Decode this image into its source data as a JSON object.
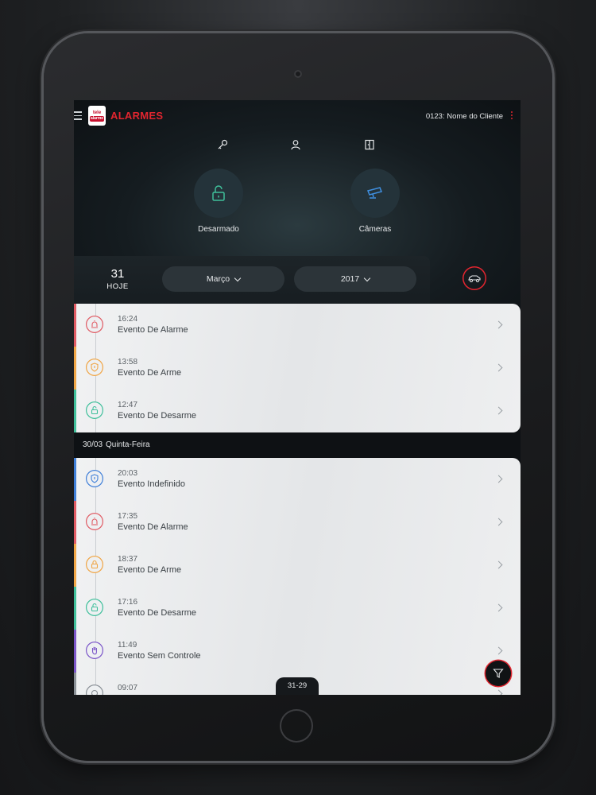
{
  "header": {
    "brand": "ALARMES",
    "logo_top": "tele",
    "logo_bottom": "alarme",
    "client": "0123: Nome do Cliente"
  },
  "quick_actions": [
    {
      "icon": "key-icon"
    },
    {
      "icon": "user-icon"
    },
    {
      "icon": "door-icon"
    }
  ],
  "main_actions": {
    "disarmed_label": "Desarmado",
    "cameras_label": "Câmeras"
  },
  "date_filter": {
    "day": "31",
    "today": "HOJE",
    "month": "Março",
    "year": "2017"
  },
  "events_today": [
    {
      "time": "16:24",
      "title": "Evento De Alarme",
      "color": "#e05a63",
      "icon": "siren-icon"
    },
    {
      "time": "13:58",
      "title": "Evento De Arme",
      "color": "#f0a545",
      "icon": "shield-icon"
    },
    {
      "time": "12:47",
      "title": "Evento De Desarme",
      "color": "#3fbf9a",
      "icon": "unlock-icon"
    }
  ],
  "section": {
    "date": "30/03",
    "weekday": "Quinta-Feira"
  },
  "events_prev": [
    {
      "time": "20:03",
      "title": "Evento Indefinido",
      "color": "#3f7fd8",
      "icon": "shield-icon"
    },
    {
      "time": "17:35",
      "title": "Evento De Alarme",
      "color": "#e05a63",
      "icon": "siren-icon"
    },
    {
      "time": "18:37",
      "title": "Evento De Arme",
      "color": "#f0a545",
      "icon": "lock-icon"
    },
    {
      "time": "17:16",
      "title": "Evento De Desarme",
      "color": "#3fbf9a",
      "icon": "unlock-icon"
    },
    {
      "time": "11:49",
      "title": "Evento Sem Controle",
      "color": "#7b55c8",
      "icon": "hand-icon"
    },
    {
      "time": "09:07",
      "title": "",
      "color": "#8a9096",
      "icon": "tool-icon"
    }
  ],
  "pager": {
    "label": "31-29"
  },
  "colors": {
    "accent": "#e1252f",
    "teal": "#3fbf9a",
    "blue": "#3f8fe0"
  }
}
